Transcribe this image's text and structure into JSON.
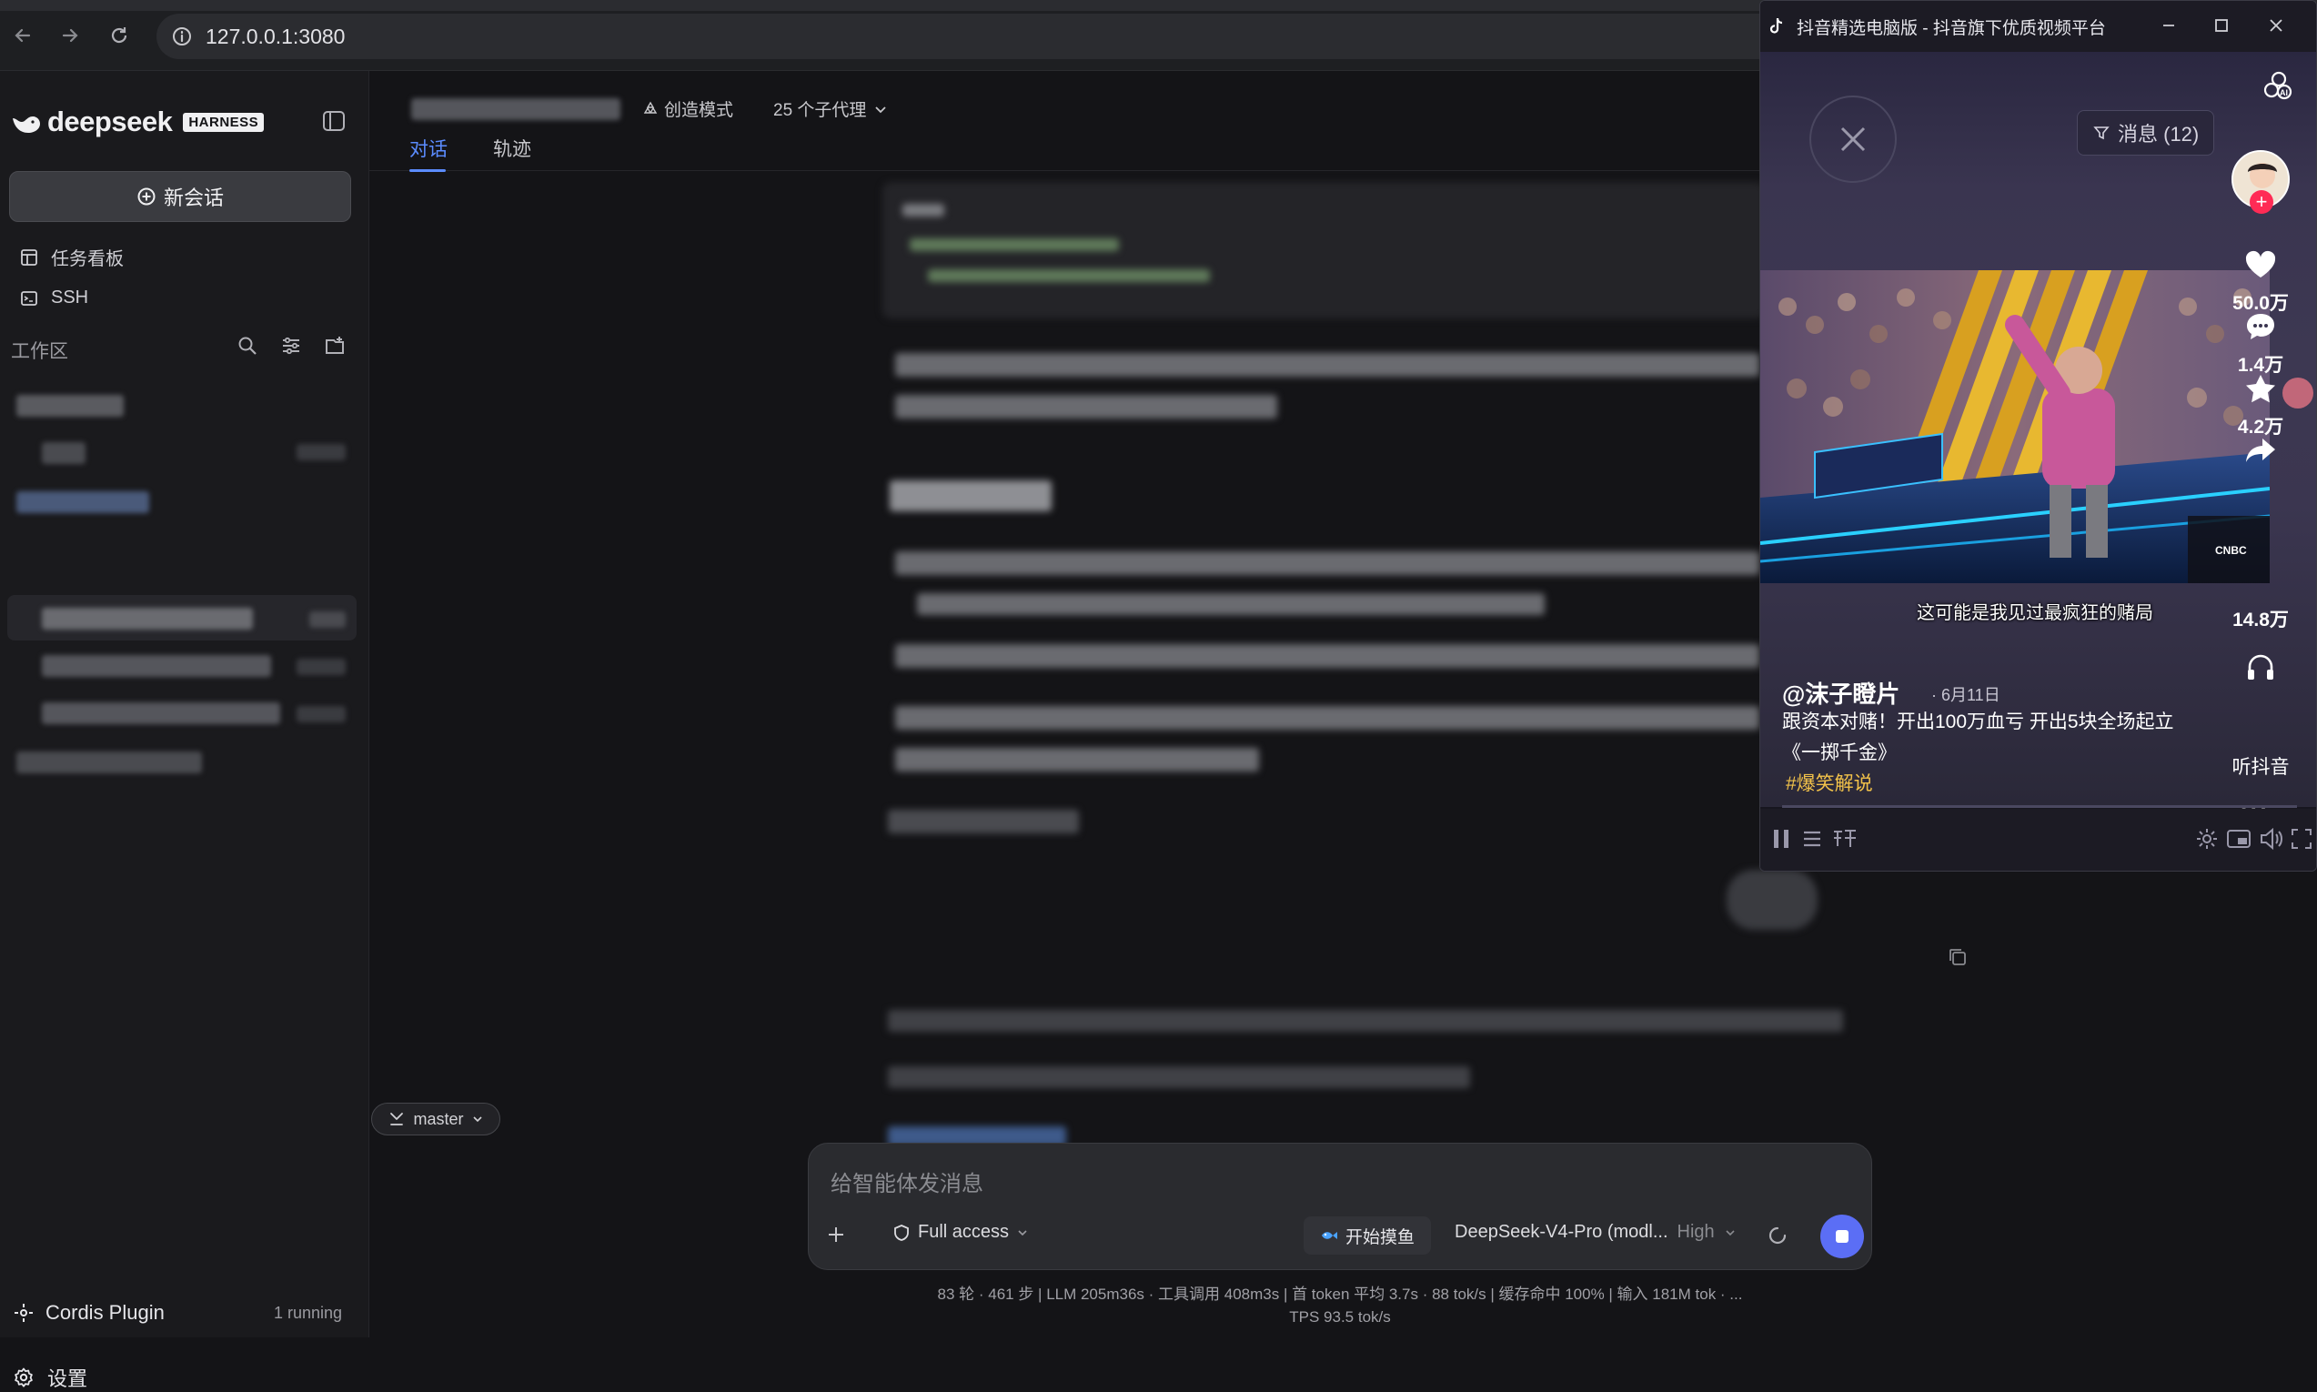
{
  "browser": {
    "url": "127.0.0.1:3080"
  },
  "sidebar": {
    "brand": "deepseek",
    "brand_badge": "HARNESS",
    "new_chat": "新会话",
    "items": [
      {
        "label": "任务看板",
        "icon": "kanban-icon"
      },
      {
        "label": "SSH",
        "icon": "terminal-icon"
      }
    ],
    "workspace_label": "工作区",
    "plugin_name": "Cordis Plugin",
    "plugin_status": "1 running",
    "settings": "设置"
  },
  "header": {
    "mode": "创造模式",
    "subagents": "25 个子代理",
    "tabs": [
      {
        "label": "对话",
        "active": true
      },
      {
        "label": "轨迹",
        "active": false
      }
    ]
  },
  "branch": "master",
  "composer": {
    "placeholder": "给智能体发消息",
    "access": "Full access",
    "fish": "开始摸鱼",
    "model": "DeepSeek-V4-Pro (modl...",
    "level": "High"
  },
  "stats": {
    "line1": "83 轮 · 461 步  |  LLM 205m36s · 工具调用 408m3s  |  首 token 平均 3.7s · 88 tok/s  |  缓存命中 100%  |  输入 181M tok · ...",
    "line2": "TPS 93.5 tok/s"
  },
  "float_window": {
    "title": "抖音精选电脑版 - 抖音旗下优质视频平台",
    "messages": "消息 (12)",
    "caption": "这可能是我见过最疯狂的赌局",
    "likes": "50.0万",
    "comments": "1.4万",
    "favorites": "4.2万",
    "shares": "14.8万",
    "author": "@沫子瞪片",
    "date": "· 6月11日",
    "description": "跟资本对赌！开出100万血亏 开出5块全场起立《一掷千金》",
    "tag": "#爆笑解说",
    "listen": "听抖音",
    "more": "···"
  },
  "colors": {
    "accent": "#5b8cff",
    "send": "#5b6ef5",
    "tag": "#f2c24a",
    "like_plus": "#ff2b55"
  }
}
